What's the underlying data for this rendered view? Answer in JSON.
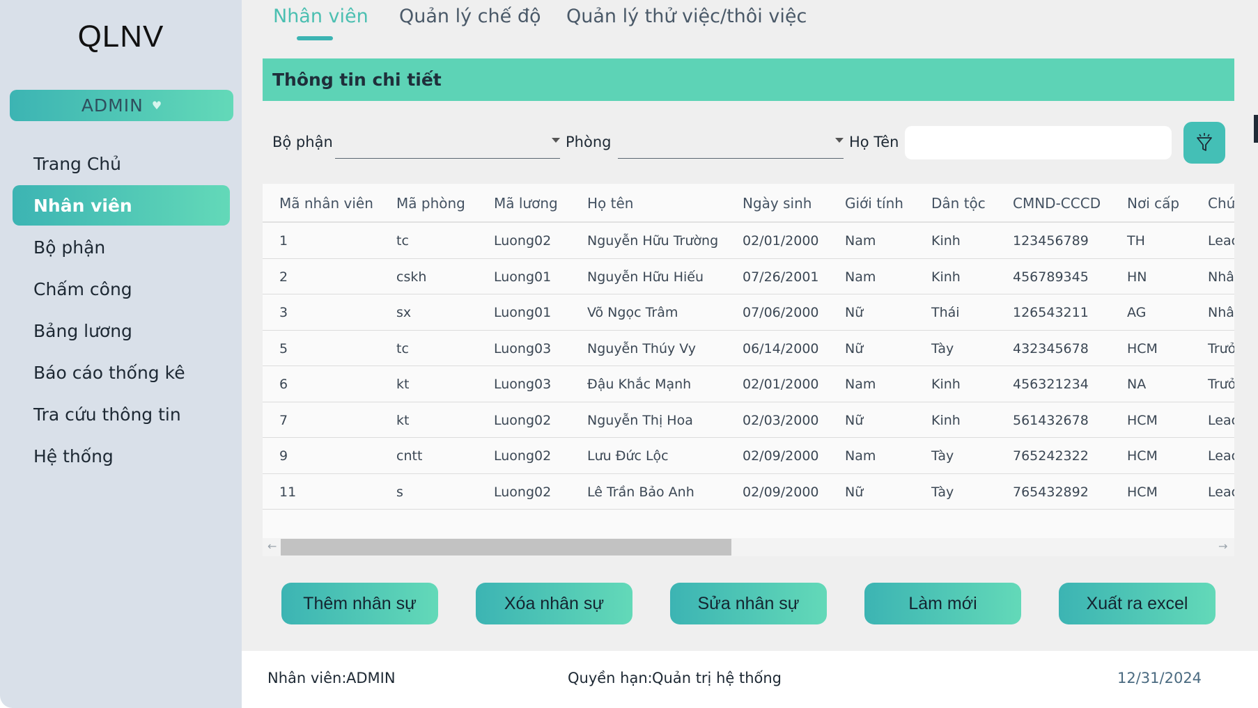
{
  "app": {
    "title": "QLNV",
    "user_menu_label": "ADMIN"
  },
  "sidebar": {
    "items": [
      {
        "label": "Trang Chủ",
        "active": false
      },
      {
        "label": "Nhân viên",
        "active": true
      },
      {
        "label": "Bộ phận",
        "active": false
      },
      {
        "label": "Chấm công",
        "active": false
      },
      {
        "label": "Bảng lương",
        "active": false
      },
      {
        "label": "Báo cáo thống kê",
        "active": false
      },
      {
        "label": "Tra cứu thông tin",
        "active": false
      },
      {
        "label": "Hệ thống",
        "active": false
      }
    ]
  },
  "tabs": [
    {
      "label": "Nhân viên",
      "active": true
    },
    {
      "label": "Quản lý chế độ",
      "active": false
    },
    {
      "label": "Quản lý thử việc/thôi việc",
      "active": false
    }
  ],
  "section": {
    "title": "Thông tin chi tiết"
  },
  "filters": {
    "department_label": "Bộ phận",
    "department_value": "",
    "room_label": "Phòng",
    "room_value": "",
    "name_label": "Họ Tên",
    "name_value": "",
    "filter_icon": "filter-icon"
  },
  "table": {
    "columns": [
      "Mã nhân viên",
      "Mã phòng",
      "Mã lương",
      "Họ tên",
      "Ngày sinh",
      "Giới tính",
      "Dân tộc",
      "CMND-CCCD",
      "Nơi cấp",
      "Chứ"
    ],
    "rows": [
      [
        "1",
        "tc",
        "Luong02",
        "Nguyễn Hữu Trường",
        "02/01/2000",
        "Nam",
        "Kinh",
        "123456789",
        "TH",
        "Leac"
      ],
      [
        "2",
        "cskh",
        "Luong01",
        "Nguyễn Hữu Hiếu",
        "07/26/2001",
        "Nam",
        "Kinh",
        "456789345",
        "HN",
        "Nhâ"
      ],
      [
        "3",
        "sx",
        "Luong01",
        "Võ Ngọc Trâm",
        "07/06/2000",
        "Nữ",
        "Thái",
        "126543211",
        "AG",
        "Nhâ"
      ],
      [
        "5",
        "tc",
        "Luong03",
        "Nguyễn Thúy Vy",
        "06/14/2000",
        "Nữ",
        "Tày",
        "432345678",
        "HCM",
        "Trưở"
      ],
      [
        "6",
        "kt",
        "Luong03",
        "Đậu Khắc Mạnh",
        "02/01/2000",
        "Nam",
        "Kinh",
        "456321234",
        "NA",
        "Trưở"
      ],
      [
        "7",
        "kt",
        "Luong02",
        "Nguyễn Thị Hoa",
        "02/03/2000",
        "Nữ",
        "Kinh",
        "561432678",
        "HCM",
        "Leac"
      ],
      [
        "9",
        "cntt",
        "Luong02",
        "Lưu Đức Lộc",
        "02/09/2000",
        "Nam",
        "Tày",
        "765242322",
        "HCM",
        "Leac"
      ],
      [
        "11",
        "s",
        "Luong02",
        "Lê Trần Bảo Anh",
        "02/09/2000",
        "Nữ",
        "Tày",
        "765432892",
        "HCM",
        "Leac"
      ]
    ]
  },
  "actions": {
    "add": "Thêm nhân sự",
    "delete": "Xóa nhân sự",
    "edit": "Sửa nhân sự",
    "refresh": "Làm mới",
    "export": "Xuất ra excel"
  },
  "status_bar": {
    "employee_label": "Nhân viên:",
    "employee_value": "ADMIN",
    "role_label": "Quyền hạn:",
    "role_value": "Quản trị hệ thống",
    "date": "12/31/2024"
  },
  "colors": {
    "accent": "#3cb4b3",
    "accent_light": "#63d9b8",
    "header_band": "#5dd3b6",
    "sidebar_bg": "#d9e0e9"
  }
}
